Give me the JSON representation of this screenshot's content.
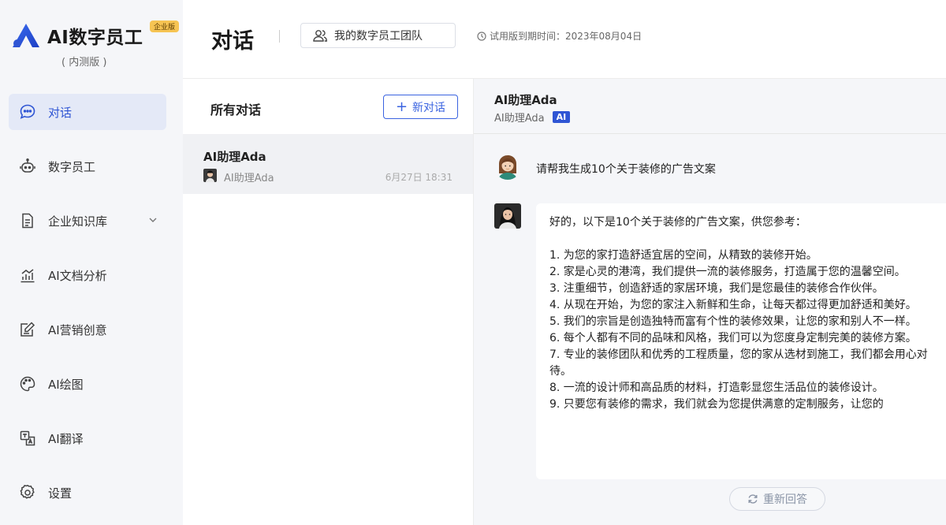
{
  "brand": {
    "title": "AI数字员工",
    "badge": "企业版",
    "subtitle": "( 内测版 )",
    "accent": "#2f55d4"
  },
  "sidebar": {
    "items": [
      {
        "label": "对话",
        "icon": "chat-bubble-icon",
        "active": true
      },
      {
        "label": "数字员工",
        "icon": "robot-icon"
      },
      {
        "label": "企业知识库",
        "icon": "document-icon",
        "expandable": true
      },
      {
        "label": "AI文档分析",
        "icon": "bar-chart-icon"
      },
      {
        "label": "AI营销创意",
        "icon": "edit-note-icon"
      },
      {
        "label": "AI绘图",
        "icon": "palette-icon"
      },
      {
        "label": "AI翻译",
        "icon": "translate-icon"
      },
      {
        "label": "设置",
        "icon": "gear-icon"
      }
    ]
  },
  "header": {
    "title": "对话",
    "team_button": "我的数字员工团队",
    "trial_expiry": "试用版到期时间：2023年08月04日"
  },
  "conversations": {
    "title": "所有对话",
    "new_button": "新对话",
    "items": [
      {
        "name": "AI助理Ada",
        "subtitle": "AI助理Ada",
        "time": "6月27日 18:31"
      }
    ]
  },
  "chat": {
    "name": "AI助理Ada",
    "subtitle": "AI助理Ada",
    "tag": "AI",
    "user_message": "请帮我生成10个关于装修的广告文案",
    "bot_intro": "好的，以下是10个关于装修的广告文案，供您参考：",
    "bot_lines": [
      "1. 为您的家打造舒适宜居的空间，从精致的装修开始。",
      "2. 家是心灵的港湾，我们提供一流的装修服务，打造属于您的温馨空间。",
      "3. 注重细节，创造舒适的家居环境，我们是您最佳的装修合作伙伴。",
      "4. 从现在开始，为您的家注入新鲜和生命，让每天都过得更加舒适和美好。",
      "5. 我们的宗旨是创造独特而富有个性的装修效果，让您的家和别人不一样。",
      "6. 每个人都有不同的品味和风格，我们可以为您度身定制完美的装修方案。",
      "7. 专业的装修团队和优秀的工程质量，您的家从选材到施工，我们都会用心对待。",
      "8. 一流的设计师和高品质的材料，打造彰显您生活品位的装修设计。",
      "9. 只要您有装修的需求，我们就会为您提供满意的定制服务，让您的"
    ],
    "regenerate_button": "重新回答"
  }
}
